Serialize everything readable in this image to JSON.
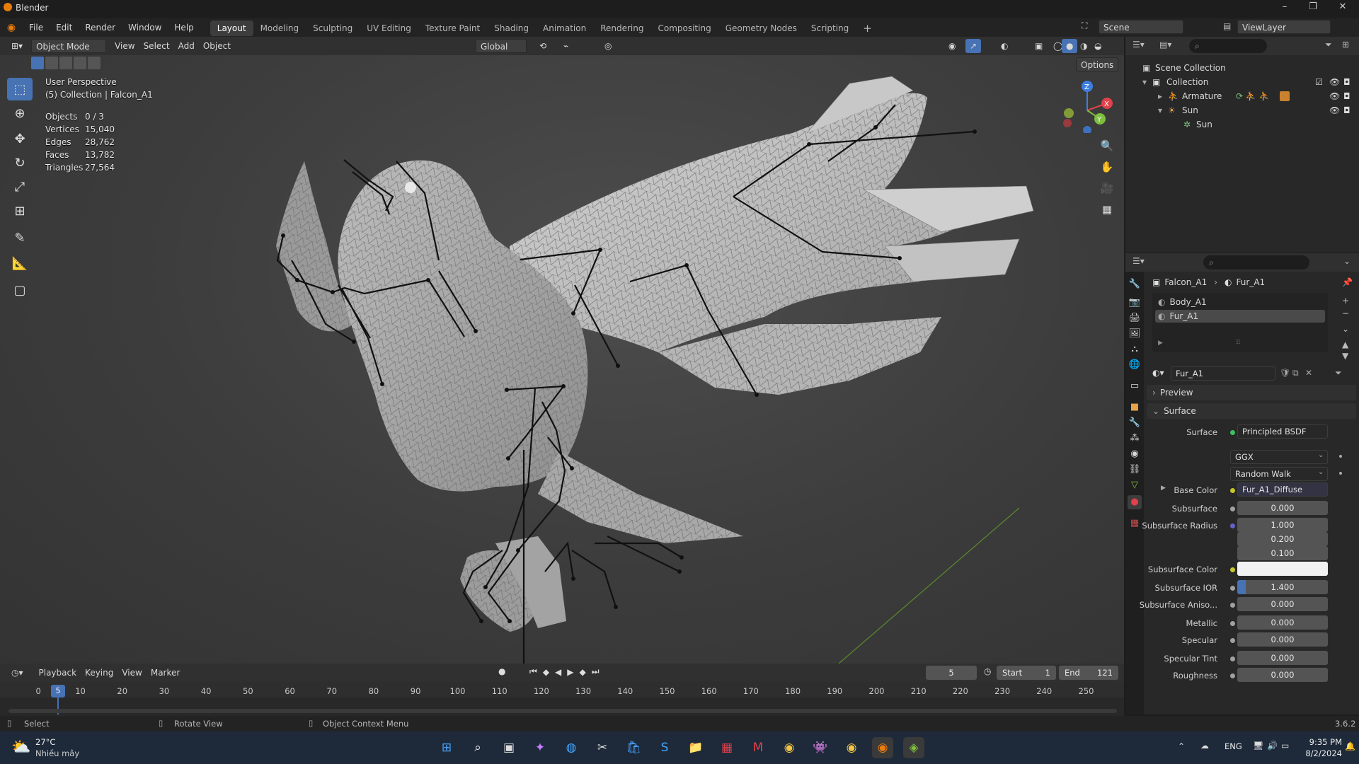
{
  "titlebar": {
    "title": "Blender",
    "minimize": "–",
    "maximize": "❐",
    "close": "✕"
  },
  "menu": [
    "File",
    "Edit",
    "Render",
    "Window",
    "Help"
  ],
  "workspaces": [
    "Layout",
    "Modeling",
    "Sculpting",
    "UV Editing",
    "Texture Paint",
    "Shading",
    "Animation",
    "Rendering",
    "Compositing",
    "Geometry Nodes",
    "Scripting"
  ],
  "scene": {
    "name": "Scene",
    "view_layer": "ViewLayer"
  },
  "viewport_header": {
    "mode": "Object Mode",
    "menus": [
      "View",
      "Select",
      "Add",
      "Object"
    ],
    "orientation": "Global",
    "options": "Options"
  },
  "viewport_overlay": {
    "perspective": "User Perspective",
    "collection": "(5) Collection | Falcon_A1",
    "stats": [
      {
        "label": "Objects",
        "value": "0 / 3"
      },
      {
        "label": "Vertices",
        "value": "15,040"
      },
      {
        "label": "Edges",
        "value": "28,762"
      },
      {
        "label": "Faces",
        "value": "13,782"
      },
      {
        "label": "Triangles",
        "value": "27,564"
      }
    ]
  },
  "gizmo": {
    "z": "Z",
    "x": "X",
    "y": "Y"
  },
  "outliner": {
    "rows": [
      {
        "label": "Scene Collection"
      },
      {
        "label": "Collection"
      },
      {
        "label": "Armature"
      },
      {
        "label": "Sun"
      },
      {
        "label": "Sun"
      }
    ]
  },
  "properties": {
    "breadcrumb_object": "Falcon_A1",
    "breadcrumb_material": "Fur_A1",
    "slots": [
      "Body_A1",
      "Fur_A1"
    ],
    "material_name": "Fur_A1",
    "panels": {
      "preview": "Preview",
      "surface": "Surface"
    },
    "surface_label": "Surface",
    "surface_value": "Principled BSDF",
    "distribution": "GGX",
    "subsurface_method": "Random Walk",
    "fields": [
      {
        "label": "Base Color",
        "value": "Fur_A1_Diffuse"
      },
      {
        "label": "Subsurface",
        "value": "0.000"
      },
      {
        "label": "Subsurface Radius",
        "value": "1.000"
      },
      {
        "label": "",
        "value": "0.200"
      },
      {
        "label": "",
        "value": "0.100"
      },
      {
        "label": "Subsurface Color",
        "value": ""
      },
      {
        "label": "Subsurface IOR",
        "value": "1.400"
      },
      {
        "label": "Subsurface Aniso...",
        "value": "0.000"
      },
      {
        "label": "Metallic",
        "value": "0.000"
      },
      {
        "label": "Specular",
        "value": "0.000"
      },
      {
        "label": "Specular Tint",
        "value": "0.000"
      },
      {
        "label": "Roughness",
        "value": "0.000"
      }
    ]
  },
  "timeline": {
    "menus": [
      "Playback",
      "Keying",
      "View",
      "Marker"
    ],
    "current_frame": "5",
    "start_label": "Start",
    "start": "1",
    "end_label": "End",
    "end": "121",
    "ticks": [
      "0",
      "10",
      "20",
      "30",
      "40",
      "50",
      "60",
      "70",
      "80",
      "90",
      "100",
      "110",
      "120",
      "130",
      "140",
      "150",
      "160",
      "170",
      "180",
      "190",
      "200",
      "210",
      "220",
      "230",
      "240",
      "250"
    ]
  },
  "statusbar": {
    "select": "Select",
    "rotate": "Rotate View",
    "context": "Object Context Menu",
    "version": "3.6.2"
  },
  "taskbar": {
    "weather_temp": "27°C",
    "weather_desc": "Nhiều mây",
    "lang": "ENG",
    "time": "9:35 PM",
    "date": "8/2/2024"
  },
  "colors": {
    "accent": "#4772b3",
    "active_tab": "#3d3d3d",
    "x_axis": "#e0414a",
    "y_axis": "#7fbf3f",
    "z_axis": "#3d7fe0"
  }
}
